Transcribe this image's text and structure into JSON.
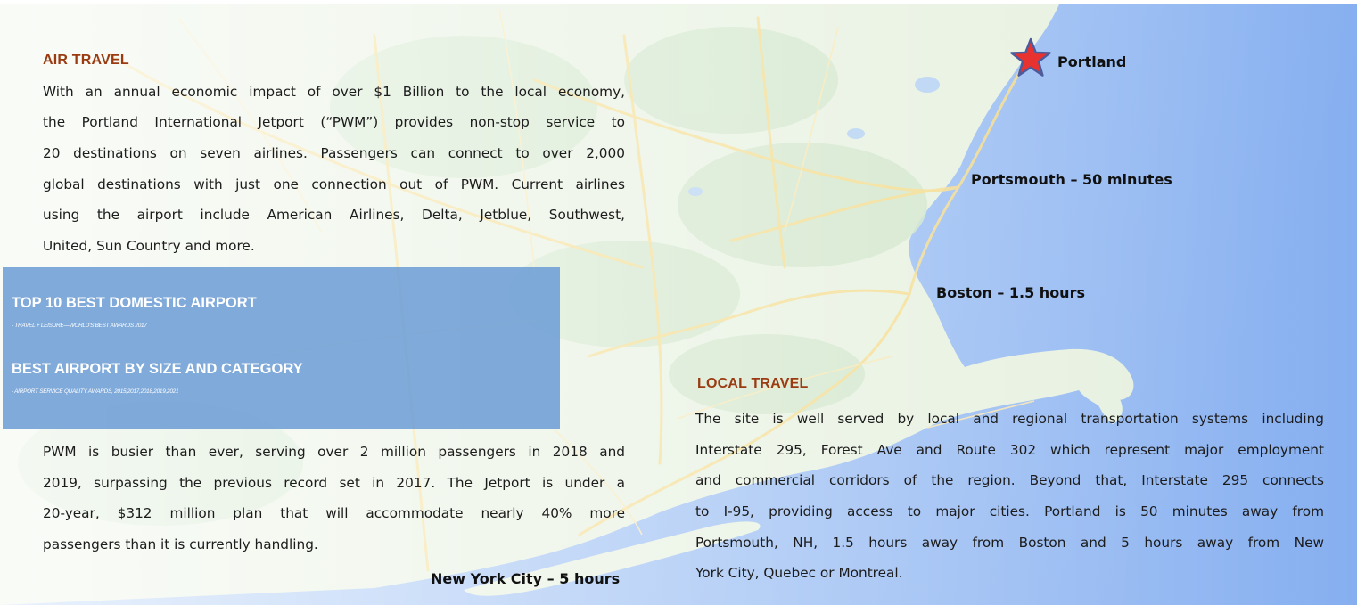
{
  "air_travel": {
    "heading": "AIR TRAVEL",
    "intro_lines": [
      "With an annual economic impact of over $1 Billion to the local economy,",
      "the Portland International Jetport (“PWM”) provides non-stop service to",
      "20 destinations on seven airlines. Passengers can connect to over 2,000",
      "global destinations with just one connection out of PWM. Current airlines",
      "using the airport include American Airlines, Delta, Jetblue, Southwest,",
      "United, Sun Country and more."
    ],
    "growth_lines": [
      "PWM is busier than ever, serving over 2 million passengers in 2018 and",
      "2019, surpassing the previous record set in 2017. The Jetport is under a",
      "20-year, $312 million plan that will accommodate nearly 40% more",
      "passengers than it is currently handling."
    ]
  },
  "awards": [
    {
      "title": "TOP 10 BEST DOMESTIC AIRPORT",
      "source": "- TRAVEL + LEISURE—WORLD'S BEST AWARDS 2017"
    },
    {
      "title": "BEST AIRPORT BY SIZE AND CATEGORY",
      "source": "- AIRPORT SERVICE QUALITY AWARDS, 2015,2017,2018,2019,2021"
    }
  ],
  "local_travel": {
    "heading": "LOCAL TRAVEL",
    "lines": [
      "The site is well served by local and regional transportation systems including",
      "Interstate 295, Forest Ave and Route 302 which represent major employment",
      "and commercial corridors of the region. Beyond that, Interstate 295 connects",
      "to I-95, providing access to major cities. Portland is 50 minutes away from",
      "Portsmouth, NH, 1.5 hours away from Boston and 5 hours away from New",
      "York City, Quebec or Montreal."
    ]
  },
  "map_labels": {
    "portland": "Portland",
    "portsmouth": "Portsmouth – 50 minutes",
    "boston": "Boston – 1.5 hours",
    "new_york": "New York City – 5 hours"
  },
  "colors": {
    "heading": "#9a3b12",
    "panel": "#6e9ed6",
    "star_fill": "#e8322f",
    "star_outline": "#4a5c9c"
  }
}
